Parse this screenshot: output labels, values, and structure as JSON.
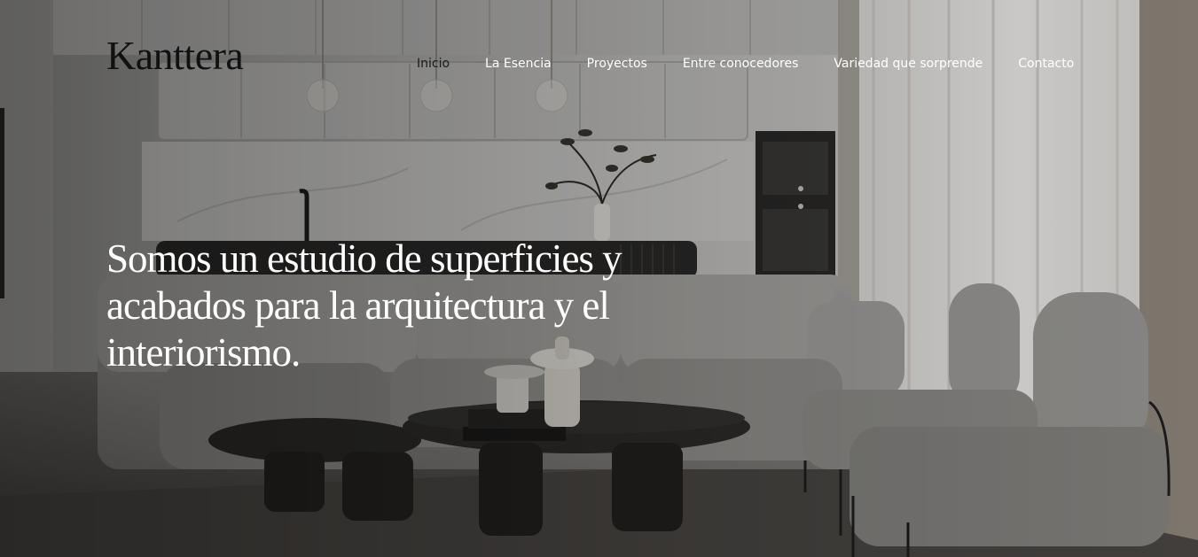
{
  "brand": {
    "logo_text": "Kanttera"
  },
  "nav": {
    "items": [
      {
        "label": "Inicio",
        "active": true
      },
      {
        "label": "La Esencia",
        "active": false
      },
      {
        "label": "Proyectos",
        "active": false
      },
      {
        "label": "Entre conocedores",
        "active": false
      },
      {
        "label": "Variedad que sorprende",
        "active": false
      },
      {
        "label": "Contacto",
        "active": false
      }
    ]
  },
  "hero": {
    "headline": "Somos un estudio de superficies y acabados para la arquitectura y el interiorismo.",
    "image": "living-room-interior-photo"
  },
  "colors": {
    "text_light": "#ffffff",
    "text_dark": "#111111"
  }
}
